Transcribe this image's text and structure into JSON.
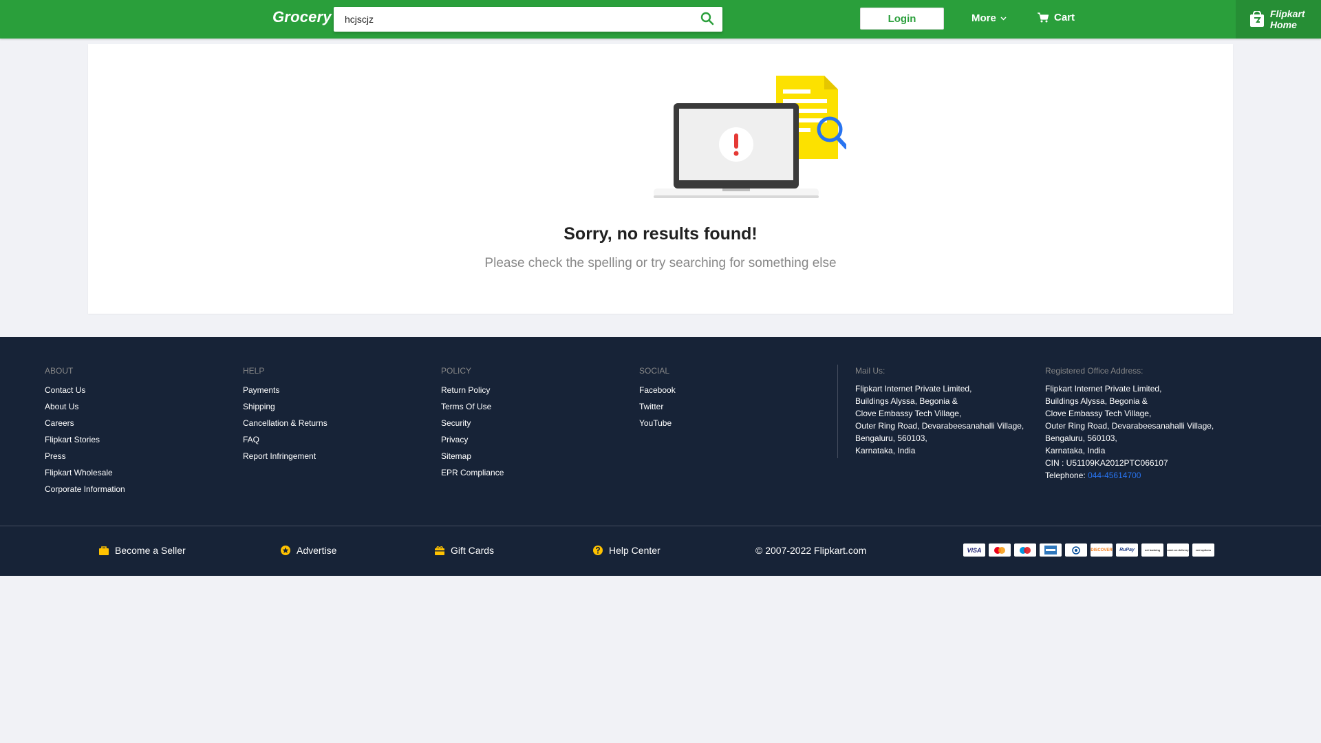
{
  "header": {
    "logo": "Grocery",
    "search_value": "hcjscjz",
    "login_label": "Login",
    "more_label": "More",
    "cart_label": "Cart",
    "home_line1": "Flipkart",
    "home_line2": "Home",
    "colors": {
      "header_bg": "#2a9f3b",
      "home_bg": "#268e35"
    }
  },
  "main": {
    "title": "Sorry, no results found!",
    "subtitle": "Please check the spelling or try searching for something else"
  },
  "footer": {
    "columns": [
      {
        "heading": "ABOUT",
        "links": [
          "Contact Us",
          "About Us",
          "Careers",
          "Flipkart Stories",
          "Press",
          "Flipkart Wholesale",
          "Corporate Information"
        ]
      },
      {
        "heading": "HELP",
        "links": [
          "Payments",
          "Shipping",
          "Cancellation & Returns",
          "FAQ",
          "Report Infringement"
        ]
      },
      {
        "heading": "POLICY",
        "links": [
          "Return Policy",
          "Terms Of Use",
          "Security",
          "Privacy",
          "Sitemap",
          "EPR Compliance"
        ]
      },
      {
        "heading": "SOCIAL",
        "links": [
          "Facebook",
          "Twitter",
          "YouTube"
        ]
      }
    ],
    "mail": {
      "heading": "Mail Us:",
      "lines": [
        "Flipkart Internet Private Limited,",
        "Buildings Alyssa, Begonia &",
        "Clove Embassy Tech Village,",
        "Outer Ring Road, Devarabeesanahalli Village,",
        "Bengaluru, 560103,",
        "Karnataka, India"
      ]
    },
    "office": {
      "heading": "Registered Office Address:",
      "lines": [
        "Flipkart Internet Private Limited,",
        "Buildings Alyssa, Begonia &",
        "Clove Embassy Tech Village,",
        "Outer Ring Road, Devarabeesanahalli Village,",
        "Bengaluru, 560103,",
        "Karnataka, India",
        "CIN : U51109KA2012PTC066107"
      ],
      "telephone_label": "Telephone: ",
      "telephone": "044-45614700"
    },
    "bottom": {
      "seller": "Become a Seller",
      "advertise": "Advertise",
      "gift_cards": "Gift Cards",
      "help_center": "Help Center",
      "copyright": "© 2007-2022 Flipkart.com"
    },
    "payment_methods": [
      "VISA",
      "mastercard",
      "maestro",
      "amex",
      "diners",
      "DISCOVER",
      "RuPay",
      "net banking",
      "cash on delivery",
      "emi options"
    ],
    "colors": {
      "footer_bg": "#172337",
      "icon_yellow": "#ffc200",
      "link_blue": "#2874f0"
    }
  }
}
